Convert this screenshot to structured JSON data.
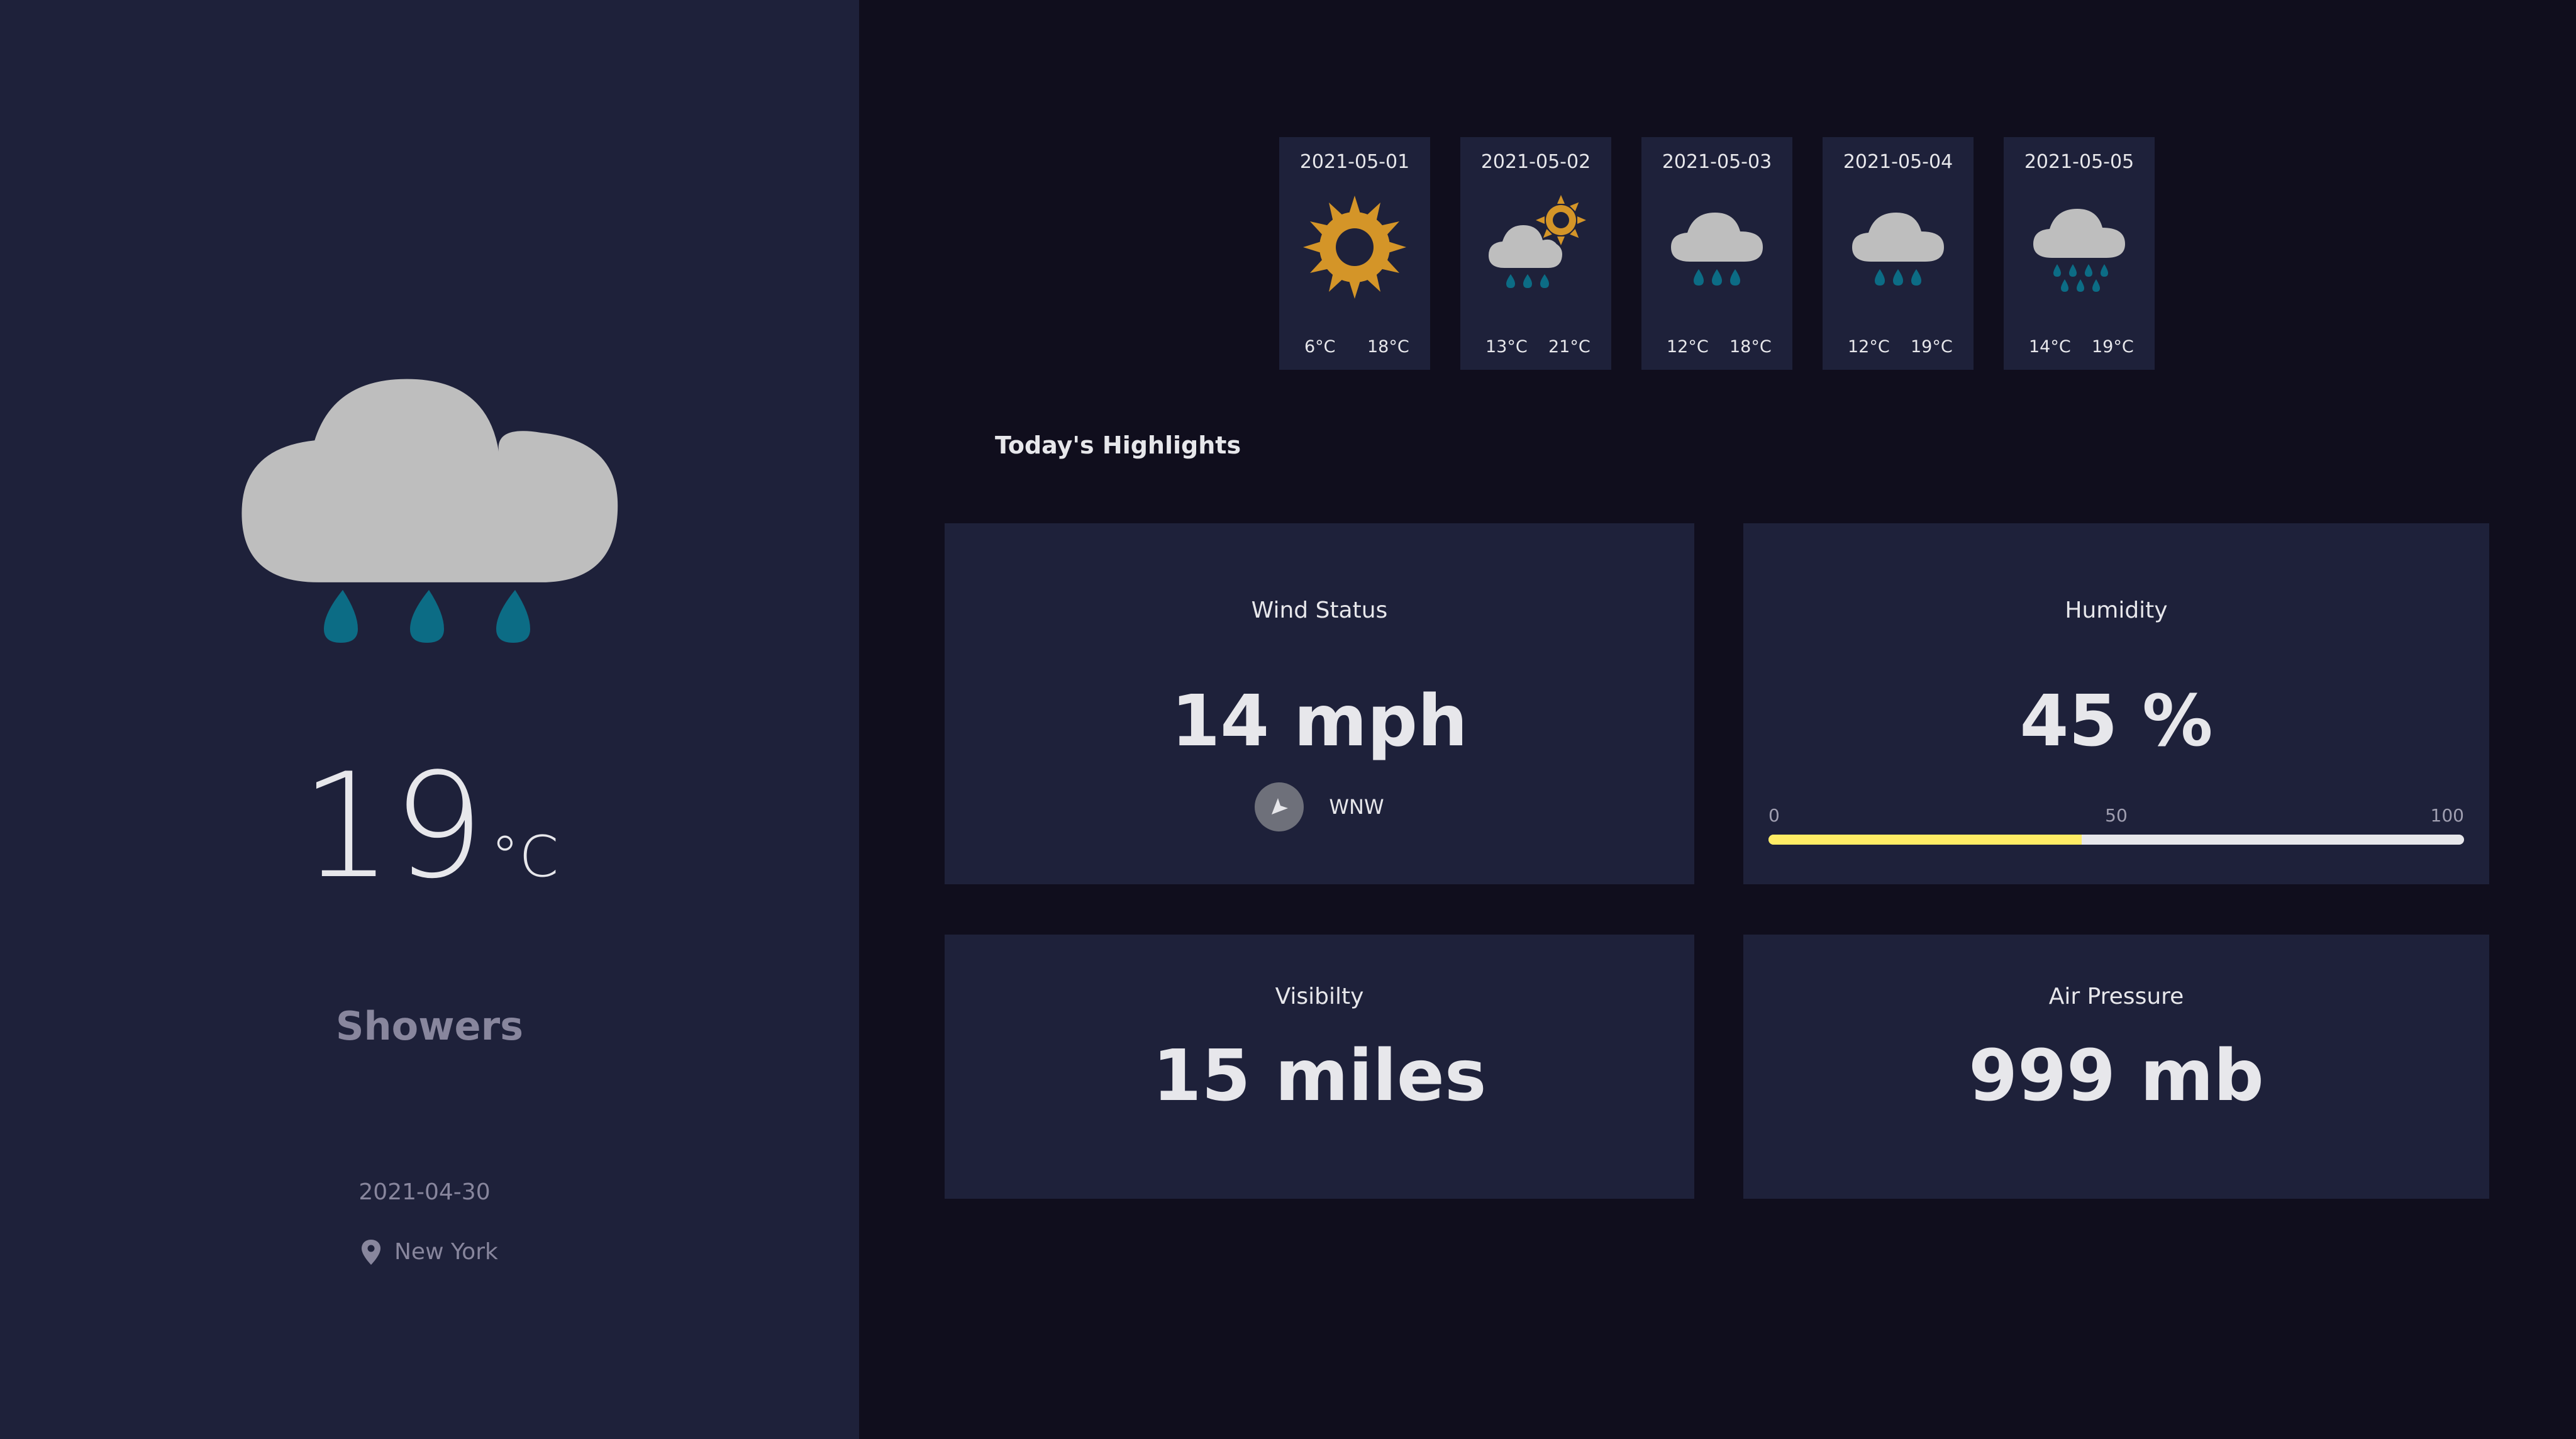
{
  "current": {
    "temperature": "19",
    "unit": "°C",
    "condition": "Showers",
    "date": "2021-04-30",
    "location": "New York",
    "icon": "shower-icon"
  },
  "forecast": [
    {
      "date": "2021-05-01",
      "min": "6°C",
      "max": "18°C",
      "icon": "sun-icon"
    },
    {
      "date": "2021-05-02",
      "min": "13°C",
      "max": "21°C",
      "icon": "light-rain-sun-icon"
    },
    {
      "date": "2021-05-03",
      "min": "12°C",
      "max": "18°C",
      "icon": "light-rain-icon"
    },
    {
      "date": "2021-05-04",
      "min": "12°C",
      "max": "19°C",
      "icon": "light-rain-icon"
    },
    {
      "date": "2021-05-05",
      "min": "14°C",
      "max": "19°C",
      "icon": "heavy-rain-icon"
    }
  ],
  "highlights": {
    "title": "Today's Highlights",
    "wind": {
      "label": "Wind Status",
      "value": "14 mph",
      "direction": "WNW"
    },
    "humidity": {
      "label": "Humidity",
      "value": "45 %",
      "percent": 45,
      "scale": {
        "min": "0",
        "mid": "50",
        "max": "100"
      }
    },
    "visibility": {
      "label": "Visibilty",
      "value": "15 miles"
    },
    "pressure": {
      "label": "Air Pressure",
      "value": "999 mb"
    }
  },
  "colors": {
    "sidebar_bg": "#1e213a",
    "page_bg": "#100e1d",
    "cloud": "#bebebe",
    "rain": "#0c6c85",
    "sun": "#d49528",
    "humidity_bar": "#ffec65"
  }
}
